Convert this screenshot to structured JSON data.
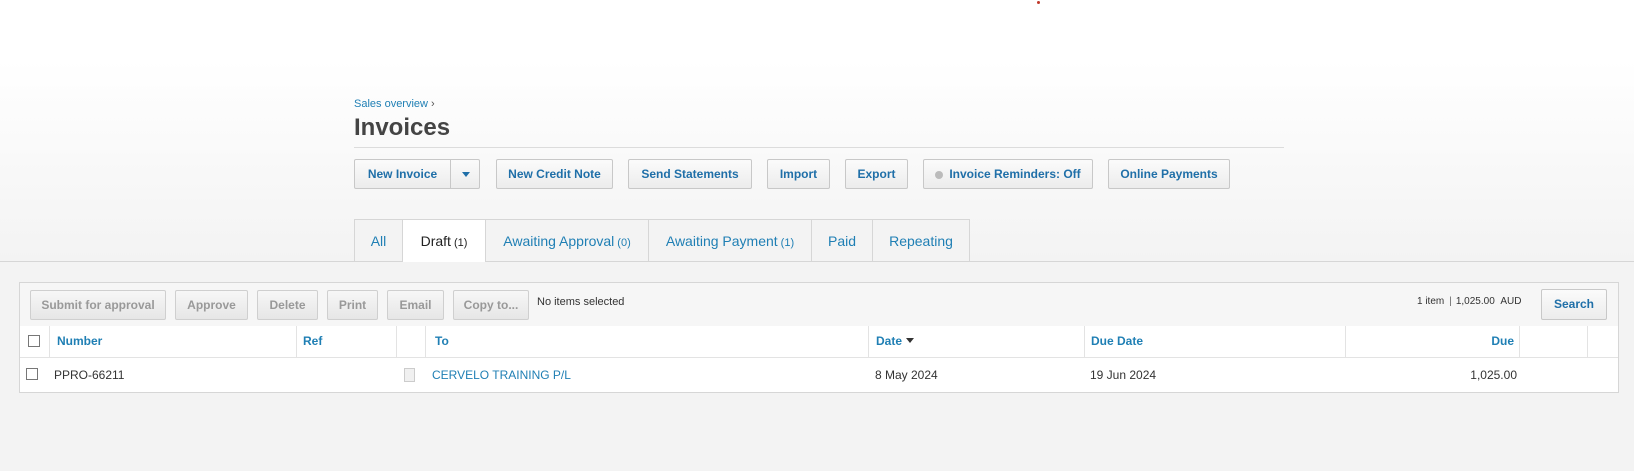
{
  "breadcrumb": {
    "link": "Sales overview",
    "separator": "›"
  },
  "page_title": "Invoices",
  "toolbar": {
    "new_invoice": "New Invoice",
    "new_credit_note": "New Credit Note",
    "send_statements": "Send Statements",
    "import": "Import",
    "export": "Export",
    "invoice_reminders": "Invoice Reminders: Off",
    "online_payments": "Online Payments"
  },
  "tabs": [
    {
      "label": "All",
      "count": ""
    },
    {
      "label": "Draft",
      "count": "(1)",
      "active": true
    },
    {
      "label": "Awaiting Approval",
      "count": "(0)"
    },
    {
      "label": "Awaiting Payment",
      "count": "(1)"
    },
    {
      "label": "Paid",
      "count": ""
    },
    {
      "label": "Repeating",
      "count": ""
    }
  ],
  "actions": {
    "submit": "Submit for approval",
    "approve": "Approve",
    "delete": "Delete",
    "print": "Print",
    "email": "Email",
    "copy_to": "Copy to...",
    "no_items": "No items selected",
    "summary_items": "1 item",
    "summary_sep": "|",
    "summary_amount": "1,025.00",
    "summary_currency": "AUD",
    "search": "Search"
  },
  "table": {
    "headers": {
      "number": "Number",
      "ref": "Ref",
      "to": "To",
      "date": "Date",
      "due_date": "Due Date",
      "due": "Due"
    },
    "rows": [
      {
        "number": "PPRO-66211",
        "ref": "",
        "to": "CERVELO TRAINING P/L",
        "date": "8 May 2024",
        "due_date": "19 Jun 2024",
        "due": "1,025.00"
      }
    ]
  },
  "colors": {
    "link": "#1f7fb4",
    "button_text": "#1f6fa8",
    "disabled_text": "#999999"
  }
}
